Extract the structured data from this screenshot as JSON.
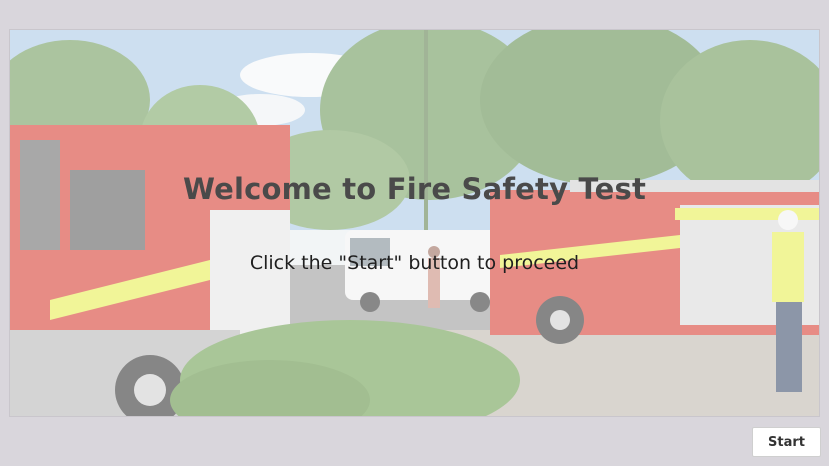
{
  "slide": {
    "title": "Welcome to Fire Safety Test",
    "instruction": "Click the \"Start\" button to proceed"
  },
  "controls": {
    "start_label": "Start"
  },
  "colors": {
    "frame_background": "#d9d6dc",
    "title_text": "#4a4a4a",
    "instruction_text": "#1f1f1f",
    "button_background": "#ffffff"
  }
}
